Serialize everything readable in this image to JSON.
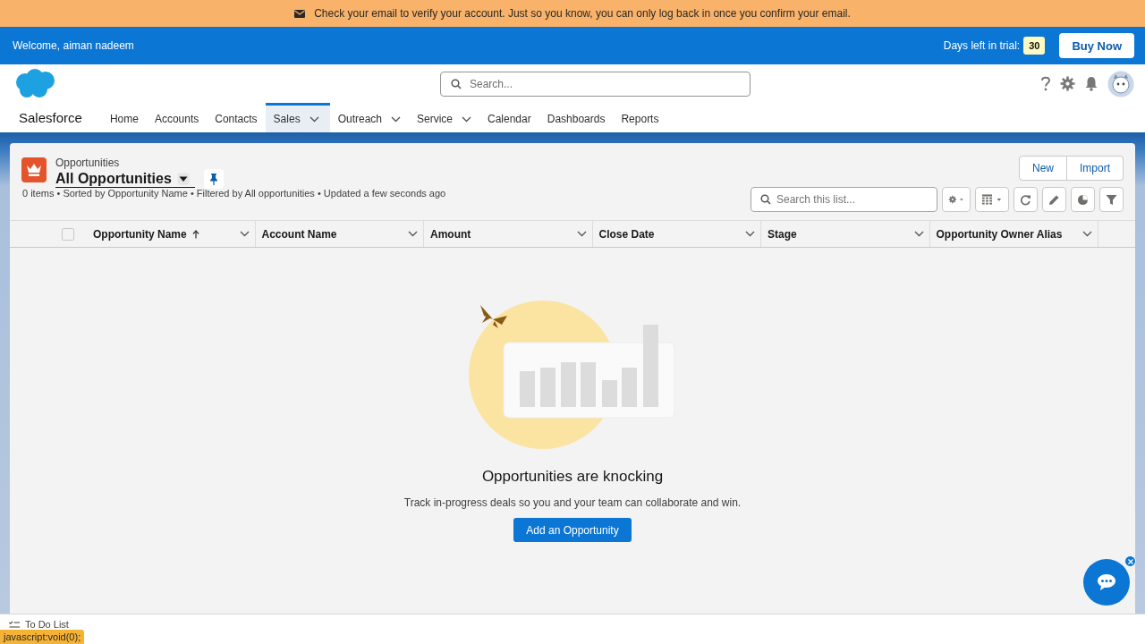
{
  "banner": {
    "message": "Check your email to verify your account. Just so you know, you can only log back in once you confirm your email."
  },
  "trial_bar": {
    "welcome": "Welcome, aiman nadeem",
    "days_label": "Days left in trial:",
    "days_left": "30",
    "buy_button": "Buy Now"
  },
  "header": {
    "search": {
      "placeholder": "Search..."
    }
  },
  "app_name": "Salesforce",
  "nav": [
    {
      "label": "Home",
      "kind": "link",
      "selected": false
    },
    {
      "label": "Accounts",
      "kind": "link",
      "selected": false
    },
    {
      "label": "Contacts",
      "kind": "link",
      "selected": false
    },
    {
      "label": "Sales",
      "kind": "menu",
      "selected": true
    },
    {
      "label": "Outreach",
      "kind": "menu",
      "selected": false
    },
    {
      "label": "Service",
      "kind": "menu",
      "selected": false
    },
    {
      "label": "Calendar",
      "kind": "link",
      "selected": false
    },
    {
      "label": "Dashboards",
      "kind": "link",
      "selected": false
    },
    {
      "label": "Reports",
      "kind": "link",
      "selected": false
    }
  ],
  "list_view": {
    "object": "Opportunities",
    "title": "All Opportunities",
    "summary": "0 items • Sorted by Opportunity Name • Filtered by All opportunities • Updated a few seconds ago",
    "buttons": [
      "New",
      "Import"
    ],
    "select_all": {
      "checked": false
    },
    "search": {
      "placeholder": "Search this list..."
    },
    "columns": [
      {
        "label": "Opportunity Name",
        "sorted": true
      },
      {
        "label": "Account Name",
        "sorted": false
      },
      {
        "label": "Amount",
        "sorted": false
      },
      {
        "label": "Close Date",
        "sorted": false
      },
      {
        "label": "Stage",
        "sorted": false
      },
      {
        "label": "Opportunity Owner Alias",
        "sorted": false
      }
    ]
  },
  "empty_state": {
    "heading": "Opportunities are knocking",
    "message": "Track in-progress deals so you and your team can collaborate and win.",
    "button": "Add an Opportunity"
  },
  "utility_bar": {
    "items": [
      "To Do List"
    ]
  },
  "status_tooltip": "javascript:void(0);"
}
